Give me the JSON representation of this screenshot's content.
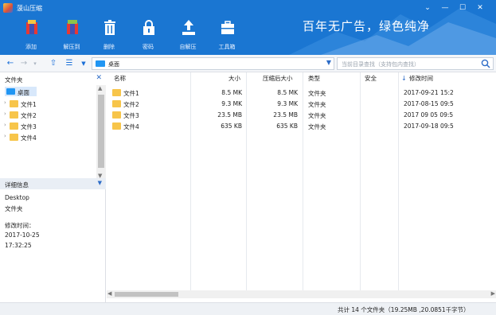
{
  "window": {
    "title": "菠山压缩",
    "minimize": "—",
    "maximize": "☐",
    "close": "✕",
    "menu": "⌄"
  },
  "slogan": "百年无广告，绿色纯净",
  "toolbar": [
    {
      "label": "添加",
      "icon": "add-archive-icon"
    },
    {
      "label": "解压到",
      "icon": "extract-to-icon"
    },
    {
      "label": "删除",
      "icon": "delete-icon"
    },
    {
      "label": "密码",
      "icon": "password-lock-icon"
    },
    {
      "label": "自解压",
      "icon": "self-extract-icon"
    },
    {
      "label": "工具箱",
      "icon": "toolbox-icon"
    }
  ],
  "nav": {
    "address": "桌面",
    "search_placeholder": "当前目录查找（支持包内查找）"
  },
  "left": {
    "header": "文件夹",
    "root": "桌面",
    "folders": [
      "文件1",
      "文件2",
      "文件3",
      "文件4"
    ],
    "detail_header": "详细信息",
    "detail": {
      "name": "Desktop",
      "type": "文件夹",
      "modified_label": "修改时间：",
      "modified_date": "2017-10-25",
      "modified_time": "17:32:25"
    }
  },
  "list": {
    "columns": [
      "名称",
      "大小",
      "压缩后大小",
      "类型",
      "安全",
      "修改时间"
    ],
    "rows": [
      {
        "name": "文件1",
        "size": "8.5 MK",
        "packed": "8.5 MK",
        "type": "文件夹",
        "safe": "",
        "modified": "2017-09-21 15:2"
      },
      {
        "name": "文件2",
        "size": "9.3 MK",
        "packed": "9.3 MK",
        "type": "文件夹",
        "safe": "",
        "modified": "2017-08-15 09:5"
      },
      {
        "name": "文件3",
        "size": "23.5 MB",
        "packed": "23.5 MB",
        "type": "文件夹",
        "safe": "",
        "modified": "2017 09 05 09:5"
      },
      {
        "name": "文件4",
        "size": "635 KB",
        "packed": "635 KB",
        "type": "文件夹",
        "safe": "",
        "modified": "2017-09-18 09:5"
      }
    ]
  },
  "status": {
    "text": "共计 14 个文件夹（19.25MB ,20.0851千字节）"
  },
  "colors": {
    "accent": "#1a76d2",
    "folder": "#f7c54a"
  }
}
